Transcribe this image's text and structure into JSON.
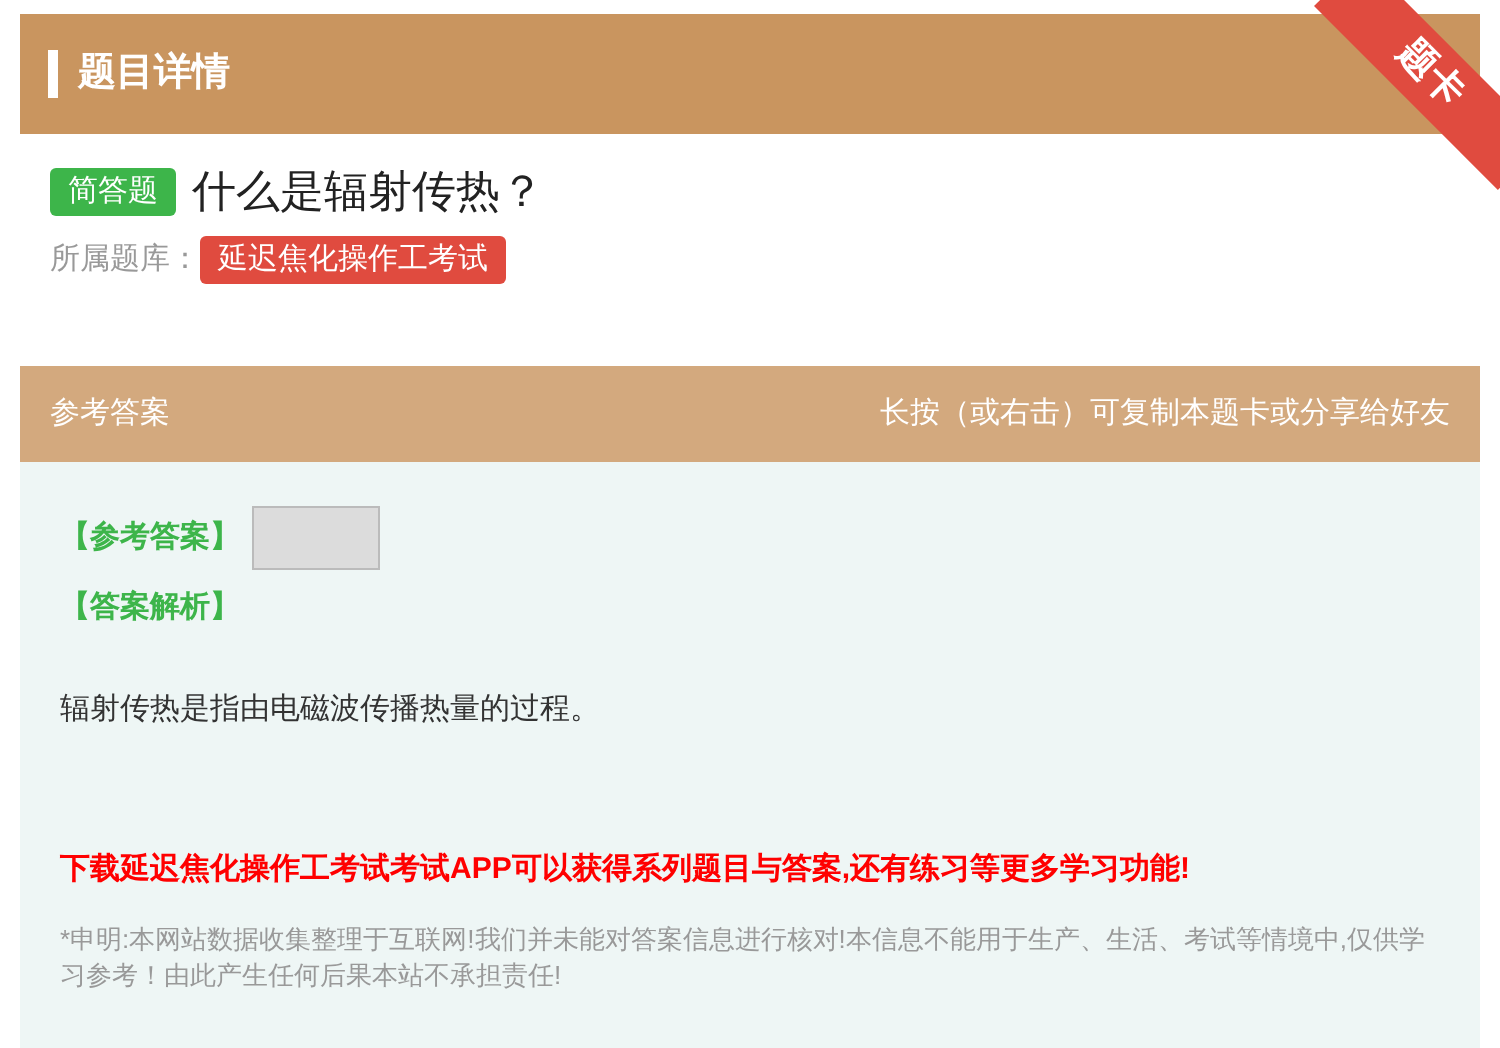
{
  "header": {
    "title": "题目详情",
    "ribbon": "题卡"
  },
  "question": {
    "type_badge": "简答题",
    "text": "什么是辐射传热？",
    "bank_label": "所属题库：",
    "bank_name": "延迟焦化操作工考试"
  },
  "answer_header": {
    "title": "参考答案",
    "hint": "长按（或右击）可复制本题卡或分享给好友"
  },
  "answer": {
    "answer_label": "【参考答案】",
    "analysis_label": "【答案解析】",
    "analysis_text": "辐射传热是指由电磁波传播热量的过程。",
    "promo": "下载延迟焦化操作工考试考试APP可以获得系列题目与答案,还有练习等更多学习功能!",
    "disclaimer": "*申明:本网站数据收集整理于互联网!我们并未能对答案信息进行核对!本信息不能用于生产、生活、考试等情境中,仅供学习参考！由此产生任何后果本站不承担责任!"
  }
}
